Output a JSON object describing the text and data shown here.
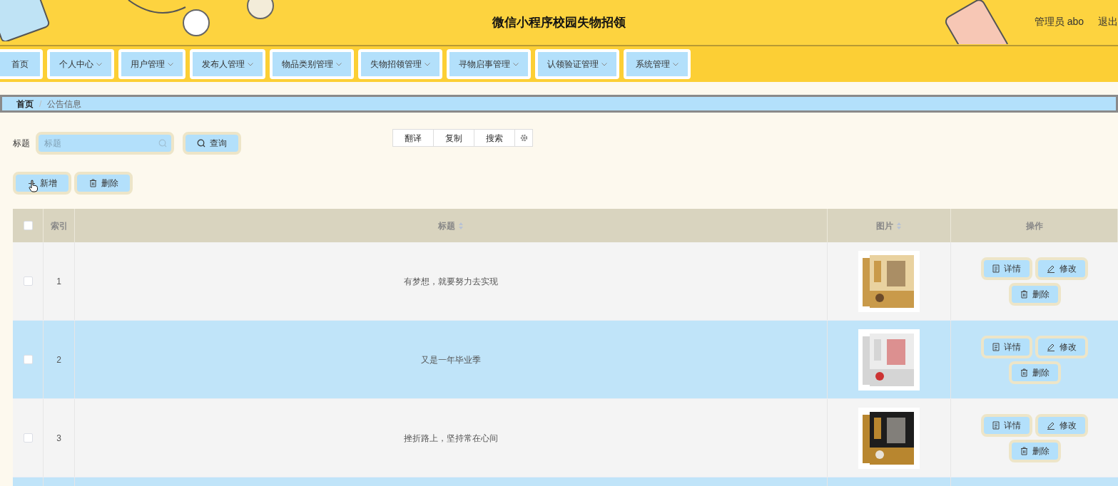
{
  "header": {
    "title": "微信小程序校园失物招领",
    "user": "管理员 abo",
    "logout": "退出"
  },
  "nav": [
    {
      "label": "首页",
      "dropdown": false
    },
    {
      "label": "个人中心",
      "dropdown": true
    },
    {
      "label": "用户管理",
      "dropdown": true
    },
    {
      "label": "发布人管理",
      "dropdown": true
    },
    {
      "label": "物品类别管理",
      "dropdown": true
    },
    {
      "label": "失物招领管理",
      "dropdown": true
    },
    {
      "label": "寻物启事管理",
      "dropdown": true
    },
    {
      "label": "认领验证管理",
      "dropdown": true
    },
    {
      "label": "系统管理",
      "dropdown": true
    }
  ],
  "breadcrumb": {
    "separator": "/",
    "items": [
      {
        "label": "首页",
        "current": false
      },
      {
        "label": "公告信息",
        "current": true
      }
    ]
  },
  "search": {
    "label": "标题",
    "placeholder": "标题",
    "button": "查询"
  },
  "float_toolbar": {
    "buttons": [
      "翻译",
      "复制",
      "搜索"
    ]
  },
  "actions": [
    {
      "label": "新增",
      "kind": "add"
    },
    {
      "label": "删除",
      "kind": "delete"
    }
  ],
  "table": {
    "select_all": {
      "checked": false
    },
    "columns": [
      {
        "label": "索引",
        "sortable": false
      },
      {
        "label": "标题",
        "sortable": true
      },
      {
        "label": "图片",
        "sortable": true
      },
      {
        "label": "操作",
        "sortable": false
      }
    ],
    "rows": [
      {
        "index": "1",
        "title": "有梦想，就要努力去实现",
        "checked": false,
        "picture": {
          "kind": "picture"
        },
        "buttons": [
          {
            "label": "详情",
            "kind": "detail"
          },
          {
            "label": "修改",
            "kind": "edit"
          },
          {
            "label": "删除",
            "kind": "delete"
          }
        ]
      },
      {
        "index": "2",
        "title": "又是一年毕业季",
        "checked": false,
        "picture": {
          "kind": "picture"
        },
        "buttons": [
          {
            "label": "详情",
            "kind": "detail"
          },
          {
            "label": "修改",
            "kind": "edit"
          },
          {
            "label": "删除",
            "kind": "delete"
          }
        ]
      },
      {
        "index": "3",
        "title": "挫折路上，坚持常在心间",
        "checked": false,
        "picture": {
          "kind": "picture"
        },
        "buttons": [
          {
            "label": "详情",
            "kind": "detail"
          },
          {
            "label": "修改",
            "kind": "edit"
          },
          {
            "label": "删除",
            "kind": "delete"
          }
        ]
      }
    ]
  }
}
